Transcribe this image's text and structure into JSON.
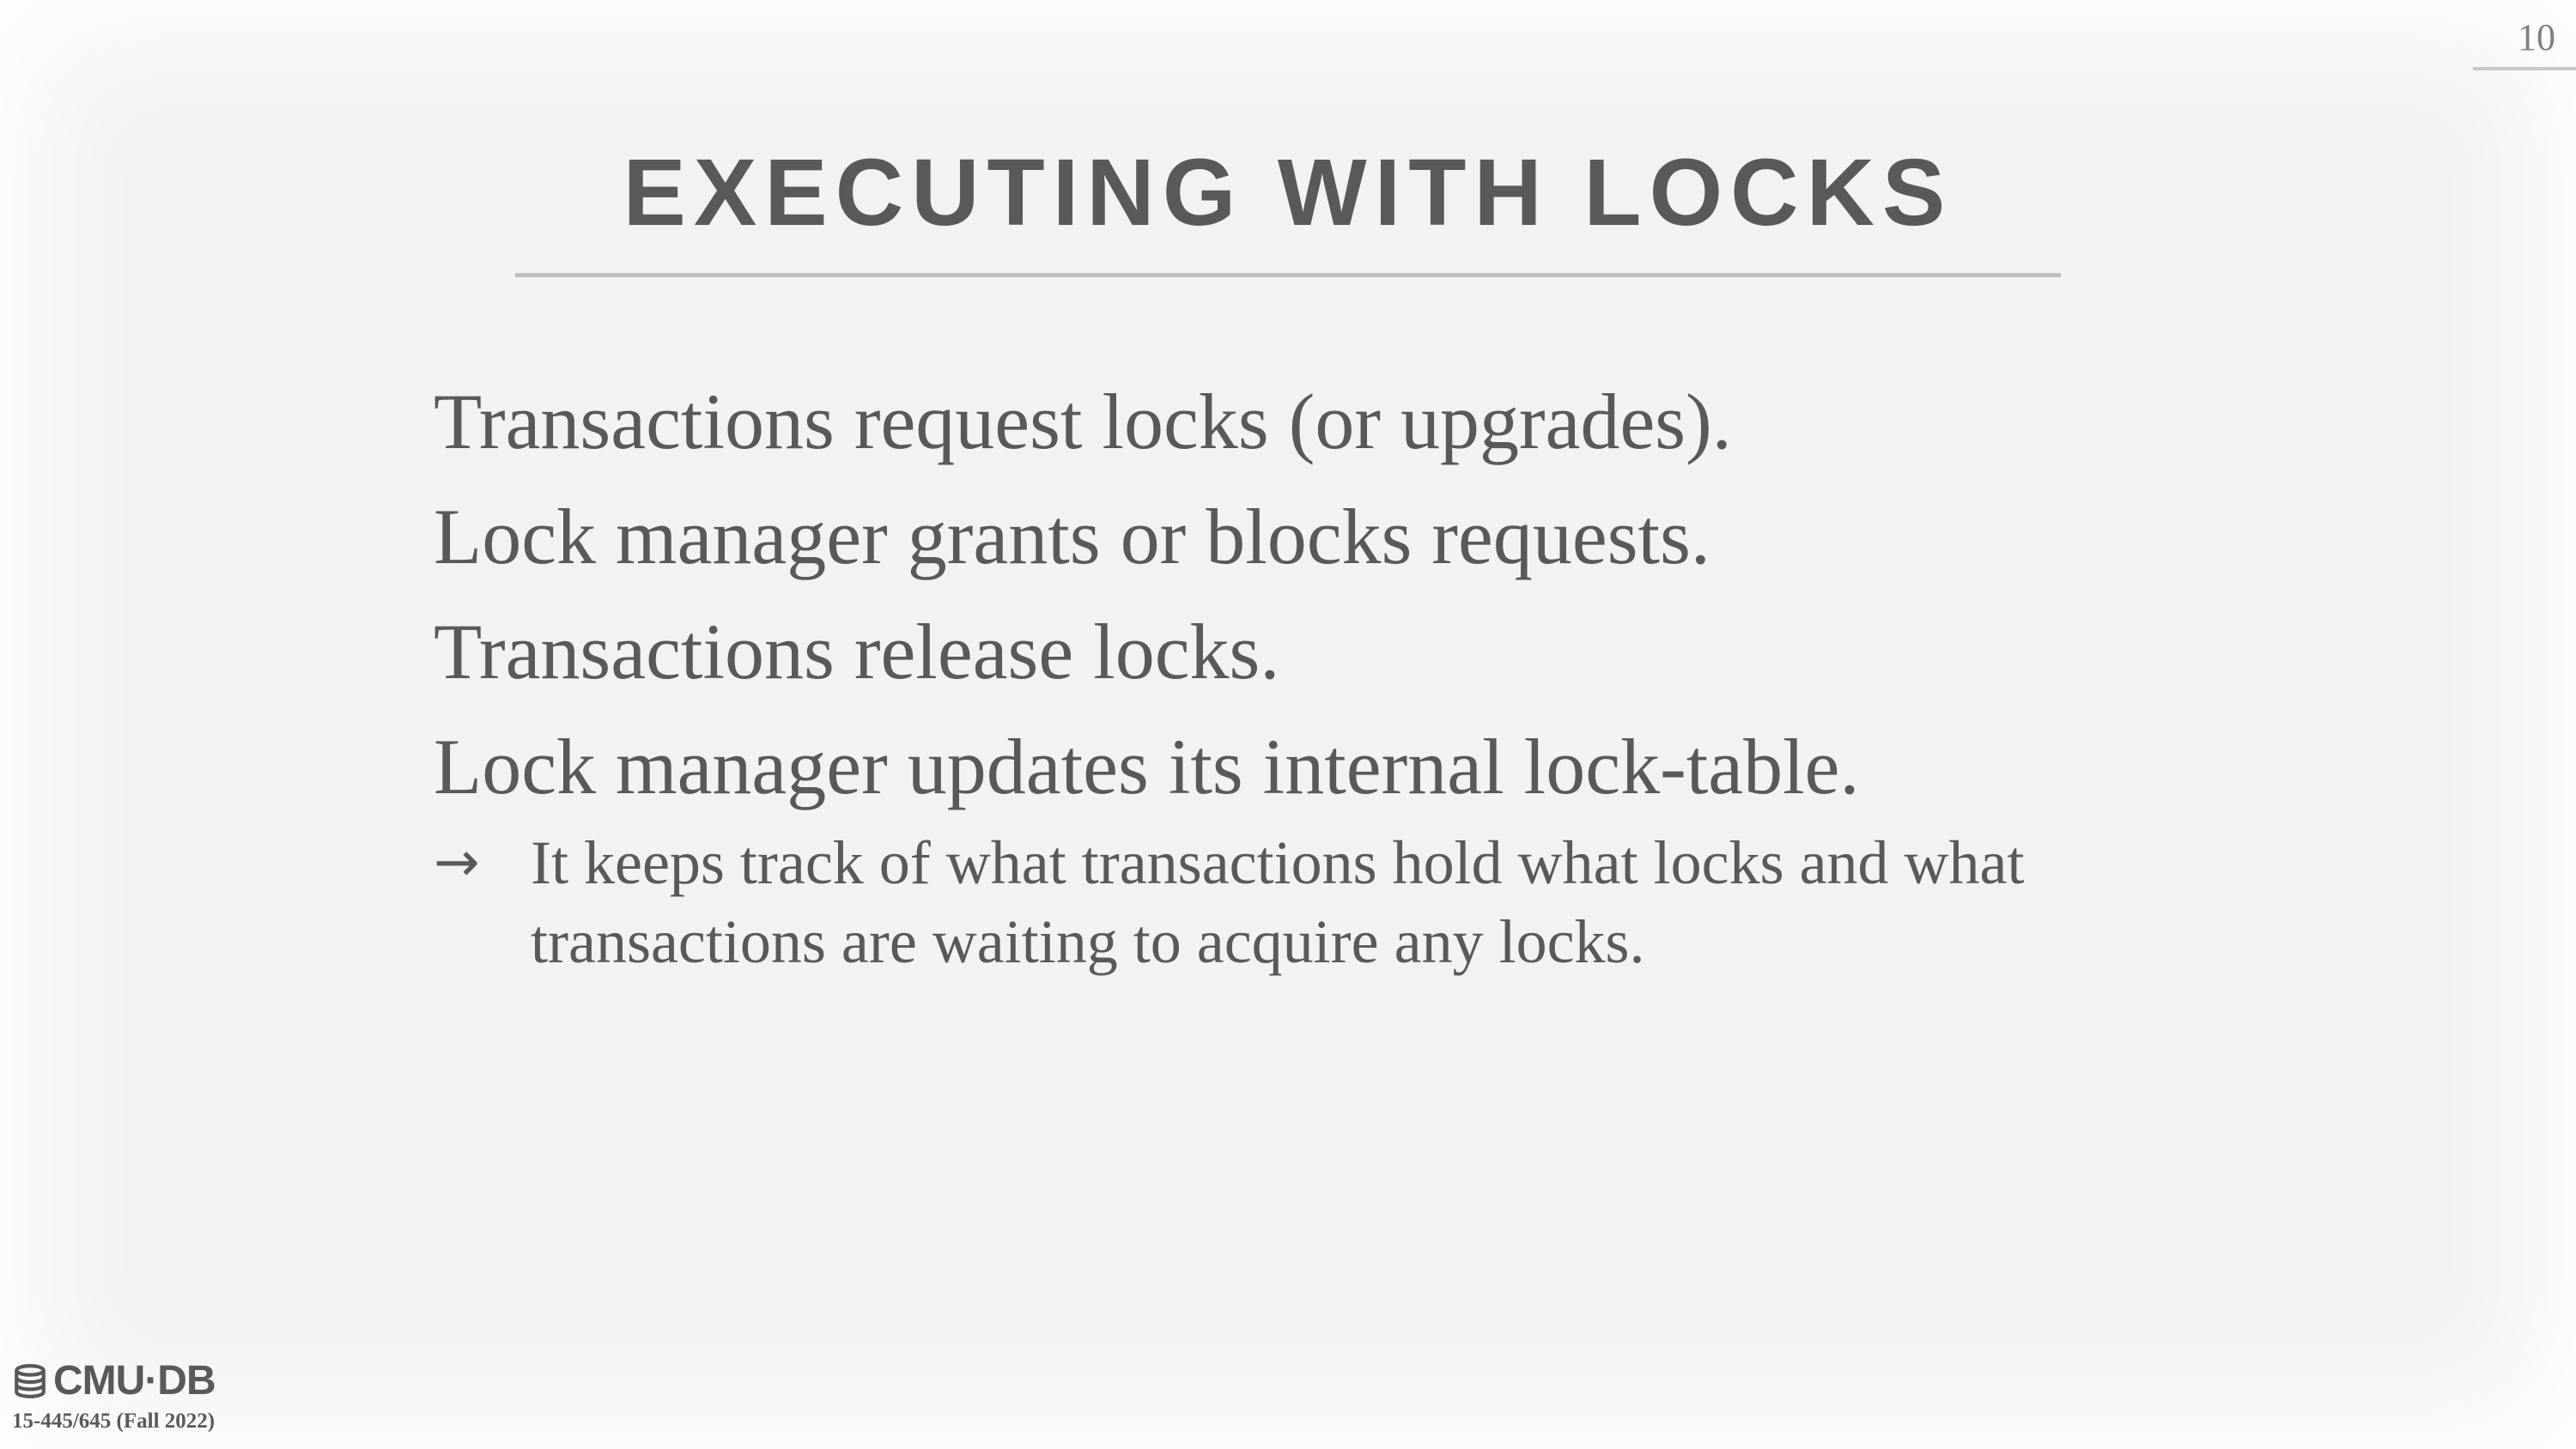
{
  "slide": {
    "page_number": "10",
    "title": "EXECUTING WITH LOCKS",
    "bullets": [
      "Transactions request locks (or upgrades).",
      "Lock manager grants or blocks requests.",
      "Transactions release locks.",
      "Lock manager updates its internal lock-table."
    ],
    "sub_bullet": {
      "arrow": "→",
      "text": "It keeps track of what transactions hold what locks and what transactions are waiting to acquire any locks."
    }
  },
  "footer": {
    "logo_text": "CMU·DB",
    "course": "15-445/645 (Fall 2022)"
  },
  "icons": {
    "logo": "database-stack-icon"
  }
}
